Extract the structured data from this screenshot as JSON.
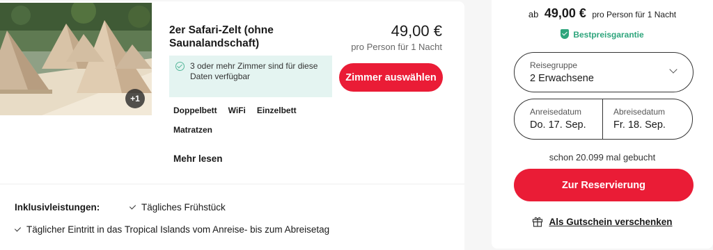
{
  "room": {
    "title": "2er Safari-Zelt (ohne Saunalandschaft)",
    "photo_badge": "+1",
    "price": "49,00 €",
    "price_note": "pro Person für 1 Nacht",
    "availability": "3 oder mehr Zimmer sind für diese Daten verfügbar",
    "select_button": "Zimmer auswählen",
    "amenities": [
      "Doppelbett",
      "WiFi",
      "Einzelbett",
      "Matratzen"
    ],
    "more_link": "Mehr lesen"
  },
  "inclusions": {
    "heading": "Inklusivleistungen:",
    "items": [
      "Tägliches Frühstück",
      "Täglicher Eintritt in das Tropical Islands vom Anreise- bis zum Abreisetag"
    ]
  },
  "booking": {
    "from_prefix": "ab",
    "from_amount": "49,00 €",
    "from_suffix": "pro Person für 1 Nacht",
    "guarantee": "Bestpreisgarantie",
    "group_label": "Reisegruppe",
    "group_value": "2 Erwachsene",
    "arrival_label": "Anreisedatum",
    "arrival_value": "Do. 17. Sep.",
    "departure_label": "Abreisedatum",
    "departure_value": "Fr. 18. Sep.",
    "booked_count": "schon 20.099 mal gebucht",
    "reserve_button": "Zur Reservierung",
    "voucher_link": "Als Gutschein verschenken"
  },
  "colors": {
    "accent": "#ea1c36",
    "success": "#2ea57c",
    "info_bg": "#e4f4f1"
  },
  "icons": [
    "check-circle-icon",
    "shield-check-icon",
    "chevron-down-icon",
    "check-icon",
    "gift-icon"
  ]
}
